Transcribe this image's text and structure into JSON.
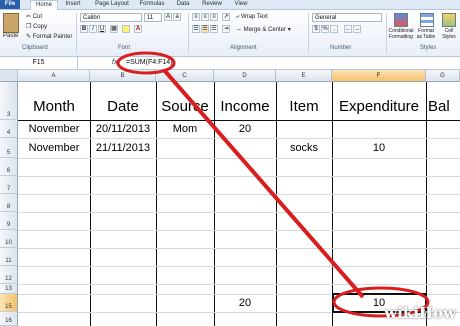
{
  "ribbon_tabs": [
    "File",
    "Home",
    "Insert",
    "Page Layout",
    "Formulas",
    "Data",
    "Review",
    "View"
  ],
  "clipboard": {
    "paste": "Paste",
    "cut": "Cut",
    "copy": "Copy",
    "format_painter": "Format Painter",
    "group": "Clipboard"
  },
  "font": {
    "name": "Calibri",
    "size": "11",
    "bold": "B",
    "italic": "I",
    "underline": "U",
    "group": "Font"
  },
  "alignment": {
    "wrap_text": "Wrap Text",
    "merge_center": "Merge & Center",
    "group": "Alignment"
  },
  "number": {
    "format": "General",
    "currency": "$",
    "percent": "%",
    "comma": ",",
    "group": "Number"
  },
  "styles": {
    "conditional": "Conditional Formatting",
    "format_table": "Format as Table",
    "cell_styles": "Cell Styles",
    "group": "Styles"
  },
  "formula_bar": {
    "name_box": "F15",
    "fx": "fx",
    "formula": "=SUM(F4:F14)"
  },
  "columns": [
    "A",
    "B",
    "C",
    "D",
    "E",
    "F",
    "G"
  ],
  "rows": [
    "3",
    "4",
    "5",
    "6",
    "7",
    "8",
    "9",
    "10",
    "11",
    "12",
    "13",
    "14",
    "15",
    "16"
  ],
  "headers": {
    "month": "Month",
    "date": "Date",
    "source": "Source",
    "income": "Income",
    "item": "Item",
    "expenditure": "Expenditure",
    "balance": "Bal"
  },
  "data_rows": [
    {
      "month": "November",
      "date": "20/11/2013",
      "source": "Mom",
      "income": "20",
      "item": "",
      "expenditure": ""
    },
    {
      "month": "November",
      "date": "21/11/2013",
      "source": "",
      "income": "",
      "item": "socks",
      "expenditure": "10"
    }
  ],
  "totals": {
    "income": "20",
    "expenditure": "10"
  },
  "watermark": "wikiHow",
  "colors": {
    "annotation": "#d81e1e",
    "selection": "#f3c26a",
    "file_tab": "#2a5fa8"
  }
}
